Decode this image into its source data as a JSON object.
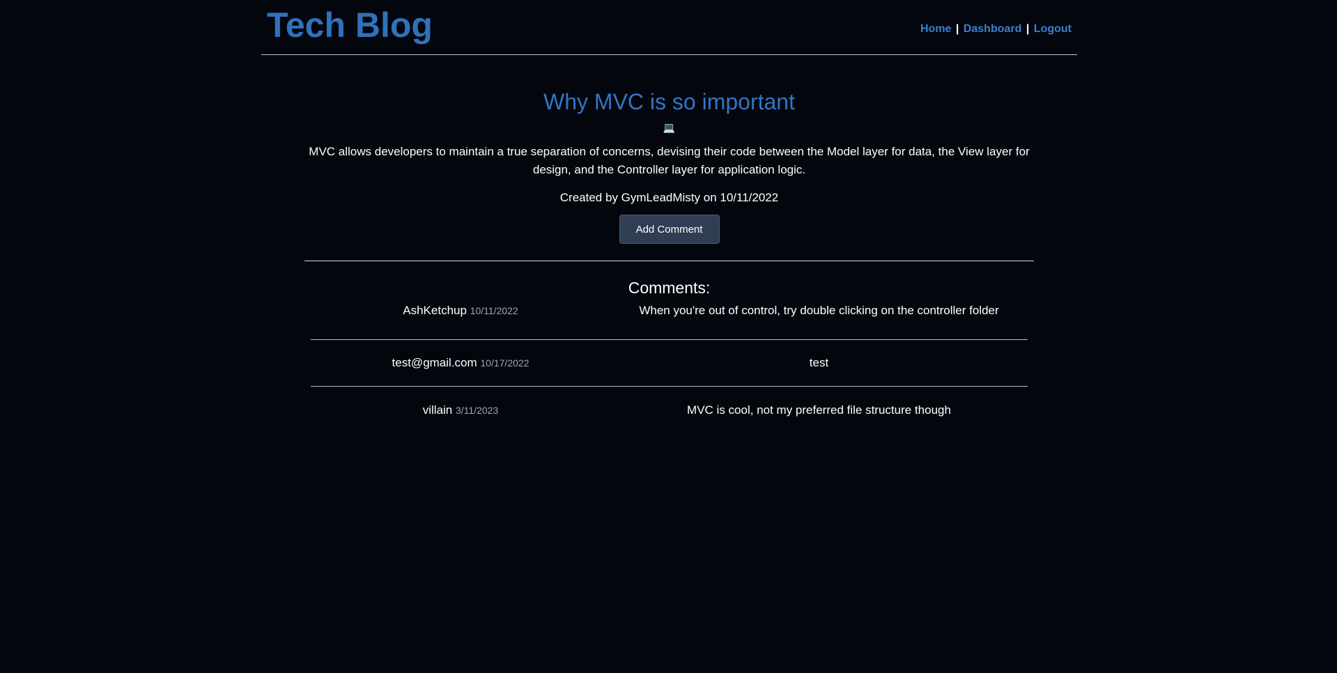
{
  "site": {
    "title": "Tech Blog",
    "nav": {
      "home": "Home",
      "separator": "|",
      "dashboard": "Dashboard",
      "logout": "Logout"
    }
  },
  "post": {
    "title": "Why MVC is so important",
    "icon": "laptop-icon",
    "icon_glyph": "💻",
    "body": "MVC allows developers to maintain a true separation of concerns, devising their code between the Model layer for data, the View layer for design, and the Controller layer for application logic.",
    "meta": "Created by GymLeadMisty on 10/11/2022",
    "add_comment_label": "Add Comment"
  },
  "comments": {
    "heading": "Comments:",
    "items": [
      {
        "author": "AshKetchup",
        "date": "10/11/2022",
        "text": "When you're out of control, try double clicking on the controller folder"
      },
      {
        "author": "test@gmail.com",
        "date": "10/17/2022",
        "text": "test"
      },
      {
        "author": "villain",
        "date": "3/11/2023",
        "text": "MVC is cool, not my preferred file structure though"
      }
    ]
  },
  "colors": {
    "background": "#03060d",
    "brand_blue": "#2f72b9",
    "link_blue": "#3d80cf",
    "button_bg": "#2f3e52"
  }
}
